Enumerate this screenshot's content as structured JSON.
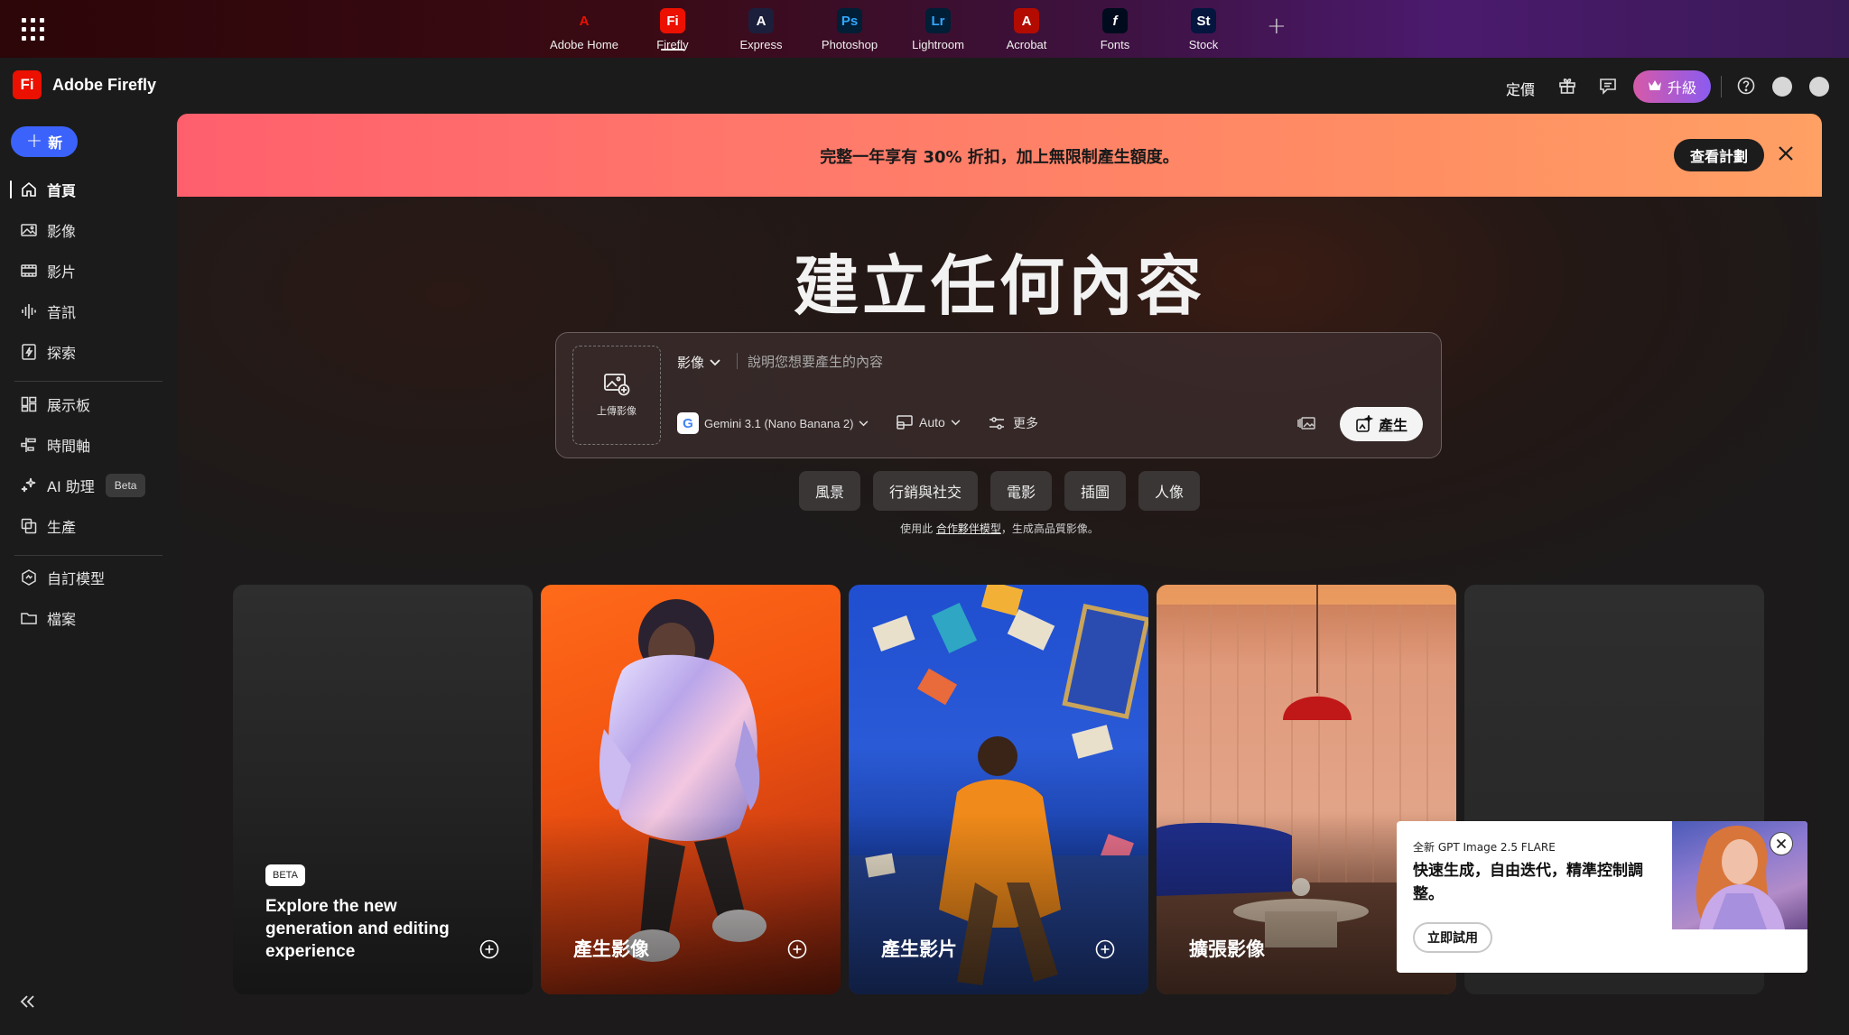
{
  "appbar": {
    "apps": [
      {
        "name": "Adobe Home",
        "glyph": "A",
        "color": "#eb1000",
        "bg": "transparent",
        "active": false
      },
      {
        "name": "Firefly",
        "glyph": "Fi",
        "color": "#ffffff",
        "bg": "#eb1000",
        "active": true
      },
      {
        "name": "Express",
        "glyph": "A",
        "color": "#ffffff",
        "bg": "#1b1f3b",
        "active": false
      },
      {
        "name": "Photoshop",
        "glyph": "Ps",
        "color": "#31a8ff",
        "bg": "#001e36",
        "active": false
      },
      {
        "name": "Lightroom",
        "glyph": "Lr",
        "color": "#31a8ff",
        "bg": "#001e36",
        "active": false
      },
      {
        "name": "Acrobat",
        "glyph": "A",
        "color": "#ffffff",
        "bg": "#b30b00",
        "active": false
      },
      {
        "name": "Fonts",
        "glyph": "f",
        "color": "#ffffff",
        "bg": "#000b1d",
        "active": false
      },
      {
        "name": "Stock",
        "glyph": "St",
        "color": "#ffffff",
        "bg": "#04153e",
        "active": false
      }
    ],
    "add_icon": "plus-icon"
  },
  "header": {
    "logo": "Fi",
    "title": "Adobe Firefly",
    "pricing": "定價",
    "upgrade": "升級"
  },
  "sidebar": {
    "new_label": "新",
    "items": [
      {
        "label": "首頁",
        "icon": "home-icon"
      },
      {
        "label": "影像",
        "icon": "image-icon"
      },
      {
        "label": "影片",
        "icon": "film-icon"
      },
      {
        "label": "音訊",
        "icon": "audio-icon"
      },
      {
        "label": "探索",
        "icon": "explore-icon"
      },
      {
        "label": "展示板",
        "icon": "boards-icon"
      },
      {
        "label": "時間軸",
        "icon": "timeline-icon"
      },
      {
        "label": "AI 助理",
        "icon": "ai-assistant-icon",
        "badge": "Beta"
      },
      {
        "label": "生產",
        "icon": "production-icon"
      },
      {
        "label": "自訂模型",
        "icon": "custom-models-icon"
      },
      {
        "label": "檔案",
        "icon": "folder-icon"
      }
    ]
  },
  "promo": {
    "message": "完整一年享有 30% 折扣，加上無限制產生額度。",
    "view_plans": "查看計劃"
  },
  "hero": {
    "title": "建立任何內容"
  },
  "prompt": {
    "upload_label": "上傳影像",
    "kind": "影像",
    "placeholder": "說明您想要產生的內容",
    "model_logo": "G",
    "model": "Gemini 3.1 (Nano Banana 2)",
    "ratio": "Auto",
    "more": "更多",
    "generate": "產生"
  },
  "chips": [
    "風景",
    "行銷與社交",
    "電影",
    "插圖",
    "人像"
  ],
  "partner_note": {
    "prefix": "使用此 ",
    "link": "合作夥伴模型",
    "suffix": "，生成高品質影像。"
  },
  "cards": {
    "explore_badge": "BETA",
    "explore_text": "Explore the new generation and editing experience",
    "image": "產生影像",
    "video": "產生影片",
    "expand": "擴張影像"
  },
  "toast": {
    "kicker": "全新 GPT Image 2.5 FLARE",
    "headline": "快速生成，自由迭代，精準控制調整。",
    "cta": "立即試用"
  }
}
